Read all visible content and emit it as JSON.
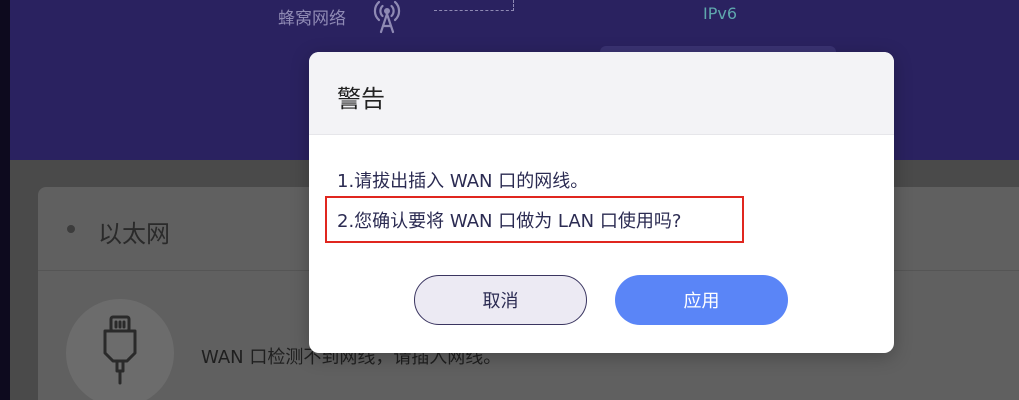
{
  "background": {
    "network_type_label": "蜂窝网络",
    "ip_version": "IPv6",
    "ethernet_section": {
      "title": "以太网",
      "status_message": "WAN 口检测不到网线，请插入网线。"
    }
  },
  "modal": {
    "title": "警告",
    "line1": "1.请拔出插入 WAN 口的网线。",
    "line2": "2.您确认要将 WAN 口做为 LAN 口使用吗?",
    "cancel_label": "取消",
    "apply_label": "应用"
  },
  "colors": {
    "hero_bg": "#2a2260",
    "overlay_bg": "#4a4a4a",
    "apply_button": "#5a85f7",
    "highlight_border": "#e0261f"
  },
  "icons": [
    "antenna-icon",
    "ethernet-cable-icon"
  ]
}
